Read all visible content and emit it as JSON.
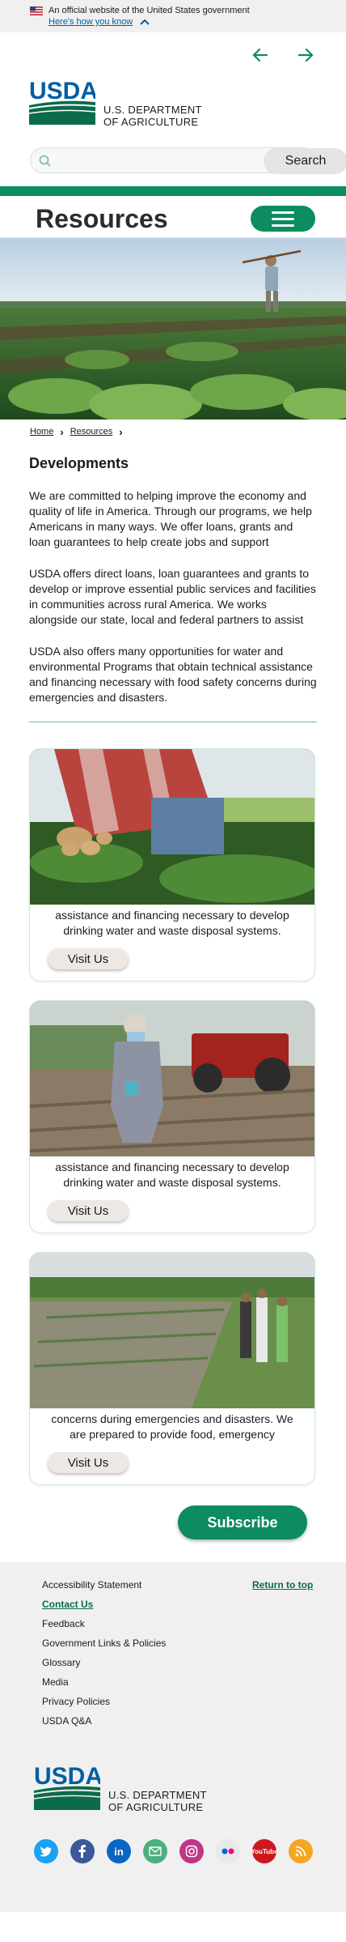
{
  "gov_banner": {
    "official_text": "An official website of the United States government",
    "how_you_know": "Here's how you know"
  },
  "logo": {
    "wordmark": "USDA",
    "dept_line1": "U.S. DEPARTMENT",
    "dept_line2": "OF AGRICULTURE"
  },
  "search": {
    "placeholder": "",
    "value": "",
    "button_label": "Search"
  },
  "page": {
    "title": "Resources"
  },
  "breadcrumb": [
    "Home",
    "Resources"
  ],
  "section": {
    "heading": "Developments",
    "paragraphs": [
      "We are committed to helping improve the economy and quality of life in America. Through our programs, we help Americans in many ways. We offer loans, grants and loan guarantees to help create jobs and support",
      "USDA offers direct loans, loan guarantees and grants to develop or improve essential public services and facilities in communities across rural America. We works alongside our state, local and federal partners to assist",
      "USDA also offers many opportunities for water and environmental Programs that obtain technical assistance and financing necessary with food safety concerns during emergencies and disasters."
    ]
  },
  "cards": [
    {
      "text": "assistance and financing necessary to develop drinking water and waste disposal systems.",
      "button_label": "Visit Us"
    },
    {
      "text": "assistance and financing necessary to develop drinking water and waste disposal systems.",
      "button_label": "Visit Us"
    },
    {
      "text": "concerns during emergencies and disasters. We are prepared to provide food, emergency",
      "button_label": "Visit Us"
    }
  ],
  "subscribe": {
    "label": "Subscribe"
  },
  "footer": {
    "links": [
      "Accessibility Statement",
      "Contact Us",
      "Feedback",
      "Government Links & Policies",
      "Glossary",
      "Media",
      "Privacy Policies",
      "USDA Q&A"
    ],
    "active_link": "Contact Us",
    "return_to_top": "Return to top",
    "social": [
      "twitter-icon",
      "facebook-icon",
      "linkedin-icon",
      "email-icon",
      "instagram-icon",
      "flickr-icon",
      "youtube-icon",
      "rss-icon"
    ]
  },
  "colors": {
    "brand_green": "#0c8c5f",
    "usda_blue": "#005ea2",
    "link_green": "#0c6b48"
  }
}
